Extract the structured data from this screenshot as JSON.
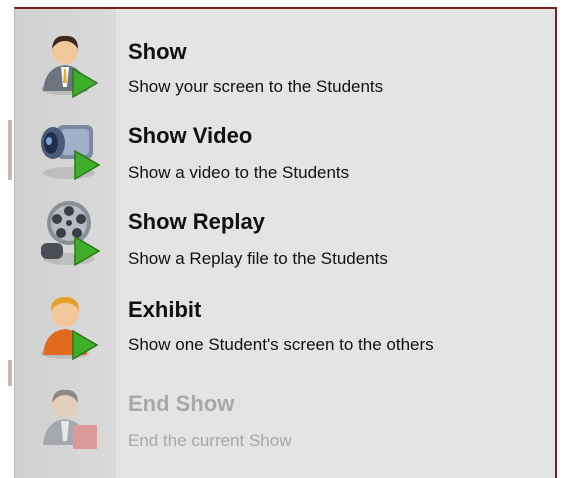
{
  "menu": {
    "items": [
      {
        "title": "Show",
        "desc": "Show your screen to the Students",
        "icon": "teacher-show-icon",
        "enabled": true
      },
      {
        "title": "Show Video",
        "desc": "Show a video to the Students",
        "icon": "video-camera-icon",
        "enabled": true
      },
      {
        "title": "Show Replay",
        "desc": "Show a Replay file to the Students",
        "icon": "film-reel-icon",
        "enabled": true
      },
      {
        "title": "Exhibit",
        "desc": "Show one Student's screen to the others",
        "icon": "student-exhibit-icon",
        "enabled": true
      },
      {
        "title": "End Show",
        "desc": "End the current Show",
        "icon": "end-show-icon",
        "enabled": false
      }
    ]
  },
  "colors": {
    "menu_background": "#e4e4e4",
    "border_accent": "#7a1f1f",
    "play_green": "#3fae2a",
    "disabled_text": "#a8a8a8"
  }
}
